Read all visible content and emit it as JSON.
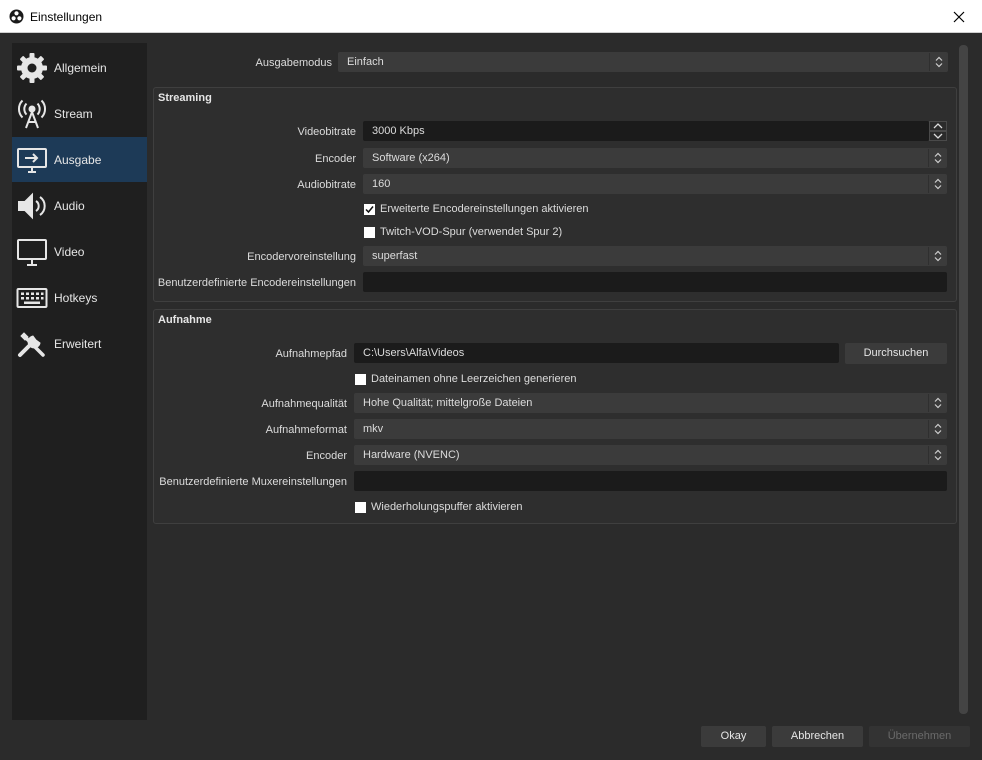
{
  "window": {
    "title": "Einstellungen"
  },
  "sidebar": {
    "items": [
      {
        "label": "Allgemein",
        "icon": "gear-icon"
      },
      {
        "label": "Stream",
        "icon": "antenna-icon"
      },
      {
        "label": "Ausgabe",
        "icon": "output-icon",
        "active": true
      },
      {
        "label": "Audio",
        "icon": "speaker-icon"
      },
      {
        "label": "Video",
        "icon": "monitor-icon"
      },
      {
        "label": "Hotkeys",
        "icon": "keyboard-icon"
      },
      {
        "label": "Erweitert",
        "icon": "tools-icon"
      }
    ]
  },
  "output_mode": {
    "label": "Ausgabemodus",
    "value": "Einfach"
  },
  "streaming": {
    "title": "Streaming",
    "video_bitrate": {
      "label": "Videobitrate",
      "value": "3000 Kbps"
    },
    "encoder": {
      "label": "Encoder",
      "value": "Software (x264)"
    },
    "audio_bitrate": {
      "label": "Audiobitrate",
      "value": "160"
    },
    "advanced_encoder": {
      "label": "Erweiterte Encodereinstellungen aktivieren",
      "checked": true
    },
    "twitch_vod": {
      "label": "Twitch-VOD-Spur (verwendet Spur 2)",
      "checked": false
    },
    "encoder_preset": {
      "label": "Encodervoreinstellung",
      "value": "superfast"
    },
    "custom_encoder": {
      "label": "Benutzerdefinierte Encodereinstellungen",
      "value": ""
    }
  },
  "recording": {
    "title": "Aufnahme",
    "path": {
      "label": "Aufnahmepfad",
      "value": "C:\\Users\\Alfa\\Videos",
      "browse_label": "Durchsuchen"
    },
    "no_spaces": {
      "label": "Dateinamen ohne Leerzeichen generieren",
      "checked": false
    },
    "quality": {
      "label": "Aufnahmequalität",
      "value": "Hohe Qualität; mittelgroße Dateien"
    },
    "format": {
      "label": "Aufnahmeformat",
      "value": "mkv"
    },
    "encoder": {
      "label": "Encoder",
      "value": "Hardware (NVENC)"
    },
    "custom_muxer": {
      "label": "Benutzerdefinierte Muxereinstellungen",
      "value": ""
    },
    "replay_buffer": {
      "label": "Wiederholungspuffer aktivieren",
      "checked": false
    }
  },
  "buttons": {
    "ok": "Okay",
    "cancel": "Abbrechen",
    "apply": "Übernehmen"
  },
  "colors": {
    "background": "#2b2b2b",
    "sidebar": "#1f1f1f",
    "active_nav": "#1d3a57",
    "input_dark": "#1b1b1b",
    "combo": "#3b3b3b"
  }
}
